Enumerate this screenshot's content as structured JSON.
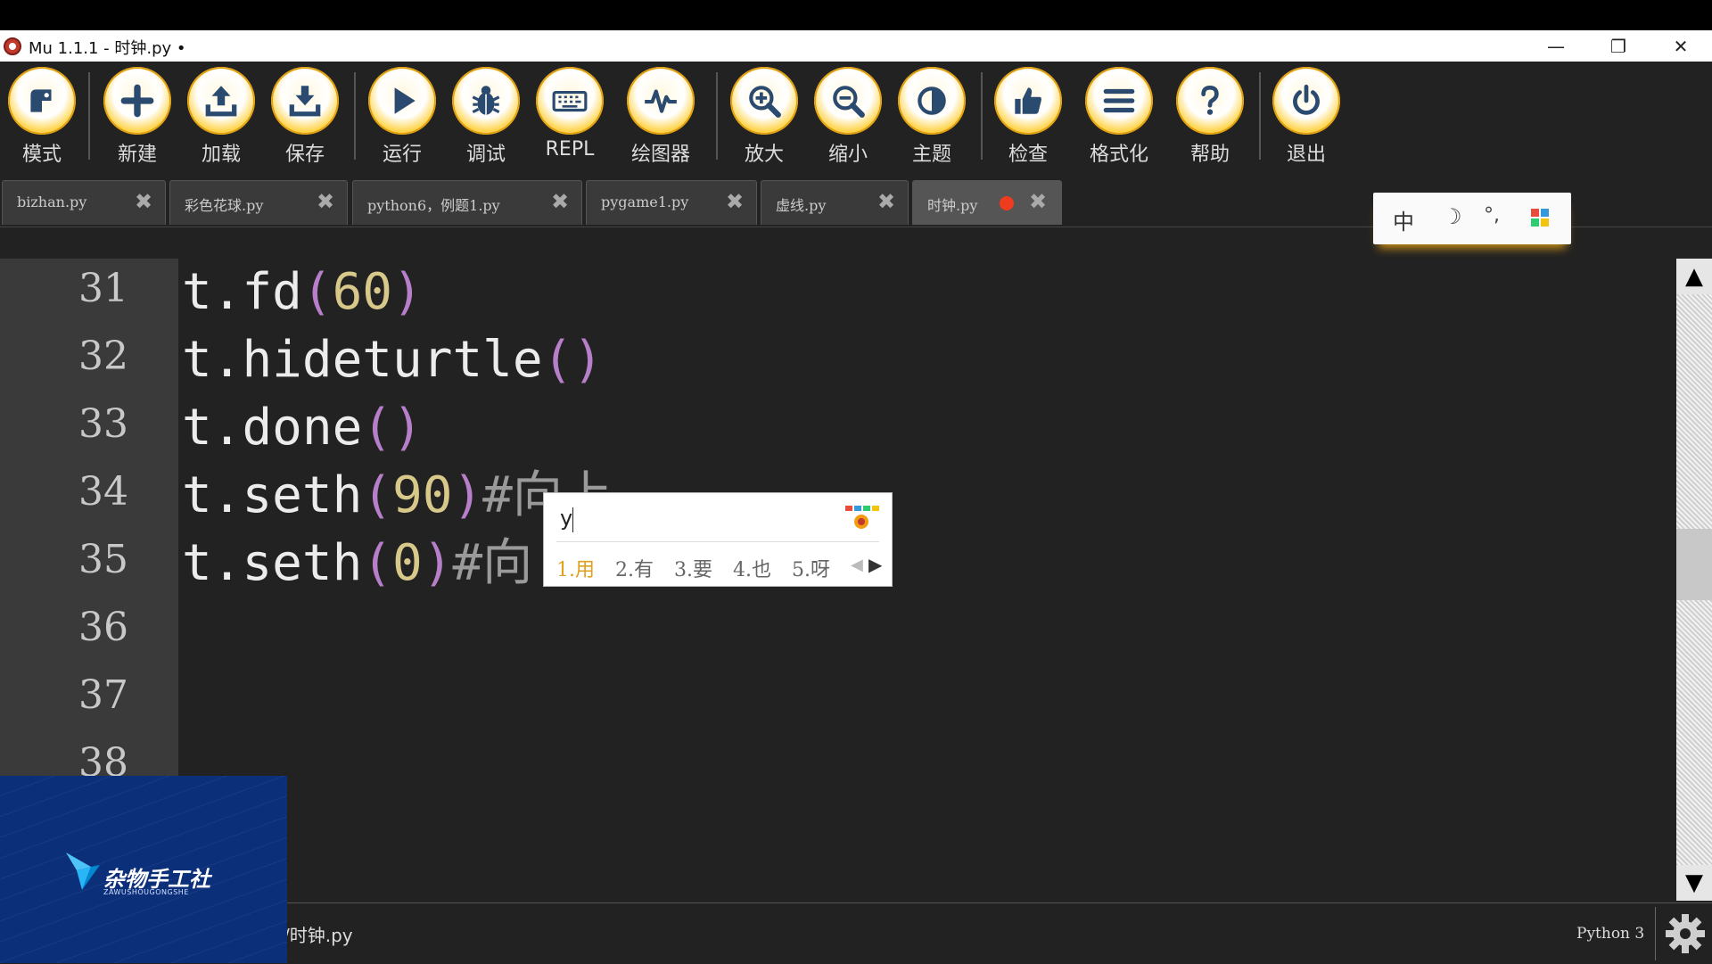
{
  "window": {
    "title": "Mu 1.1.1 - 时钟.py •",
    "controls": {
      "minimize": "—",
      "restore": "❐",
      "close": "✕"
    }
  },
  "toolbar": {
    "buttons": [
      {
        "label": "模式",
        "icon": "mode-icon"
      },
      {
        "label": "新建",
        "icon": "plus-icon"
      },
      {
        "label": "加载",
        "icon": "upload-icon"
      },
      {
        "label": "保存",
        "icon": "download-icon"
      },
      {
        "label": "运行",
        "icon": "play-icon"
      },
      {
        "label": "调试",
        "icon": "bug-icon"
      },
      {
        "label": "REPL",
        "icon": "keyboard-icon"
      },
      {
        "label": "绘图器",
        "icon": "pulse-icon"
      },
      {
        "label": "放大",
        "icon": "zoom-in-icon"
      },
      {
        "label": "缩小",
        "icon": "zoom-out-icon"
      },
      {
        "label": "主题",
        "icon": "contrast-icon"
      },
      {
        "label": "检查",
        "icon": "thumbs-up-icon"
      },
      {
        "label": "格式化",
        "icon": "list-icon"
      },
      {
        "label": "帮助",
        "icon": "question-icon"
      },
      {
        "label": "退出",
        "icon": "power-icon"
      }
    ]
  },
  "tabs": [
    {
      "name": "bizhan.py",
      "close": "✖"
    },
    {
      "name": "彩色花球.py",
      "close": "✖"
    },
    {
      "name": "python6，例题1.py",
      "close": "✖"
    },
    {
      "name": "pygame1.py",
      "close": "✖"
    },
    {
      "name": "虚线.py",
      "close": "✖"
    },
    {
      "name": "时钟.py",
      "close": "✖",
      "active": true,
      "modified": true
    }
  ],
  "ime_status": {
    "mode": "中",
    "moon": "☽",
    "punct": "°,",
    "grid": "▦"
  },
  "editor": {
    "line_numbers": [
      "31",
      "32",
      "33",
      "34",
      "35",
      "36",
      "37",
      "38"
    ],
    "lines": [
      {
        "obj": "t",
        "dot": ".",
        "fn": "fd",
        "open": "(",
        "arg": "60",
        "close": ")",
        "comment": ""
      },
      {
        "obj": "t",
        "dot": ".",
        "fn": "hideturtle",
        "open": "(",
        "arg": "",
        "close": ")",
        "comment": ""
      },
      {
        "obj": "t",
        "dot": ".",
        "fn": "done",
        "open": "(",
        "arg": "",
        "close": ")",
        "comment": ""
      },
      {
        "obj": "t",
        "dot": ".",
        "fn": "seth",
        "open": "(",
        "arg": "90",
        "close": ")",
        "comment": "#向上"
      },
      {
        "obj": "t",
        "dot": ".",
        "fn": "seth",
        "open": "(",
        "arg": "0",
        "close": ")",
        "comment": "#向"
      }
    ]
  },
  "ime_popup": {
    "input": "y",
    "candidates": [
      "1.用",
      "2.有",
      "3.要",
      "4.也",
      "5.呀"
    ],
    "prev": "◀",
    "next": "▶"
  },
  "scrollbar": {
    "up": "▲",
    "down": "▼",
    "position": 0.47
  },
  "statusbar": {
    "path": "/时钟.py",
    "mode": "Python 3"
  },
  "watermark": {
    "name": "杂物手工社",
    "sub": "ZAWUSHOUGONGSHE"
  }
}
